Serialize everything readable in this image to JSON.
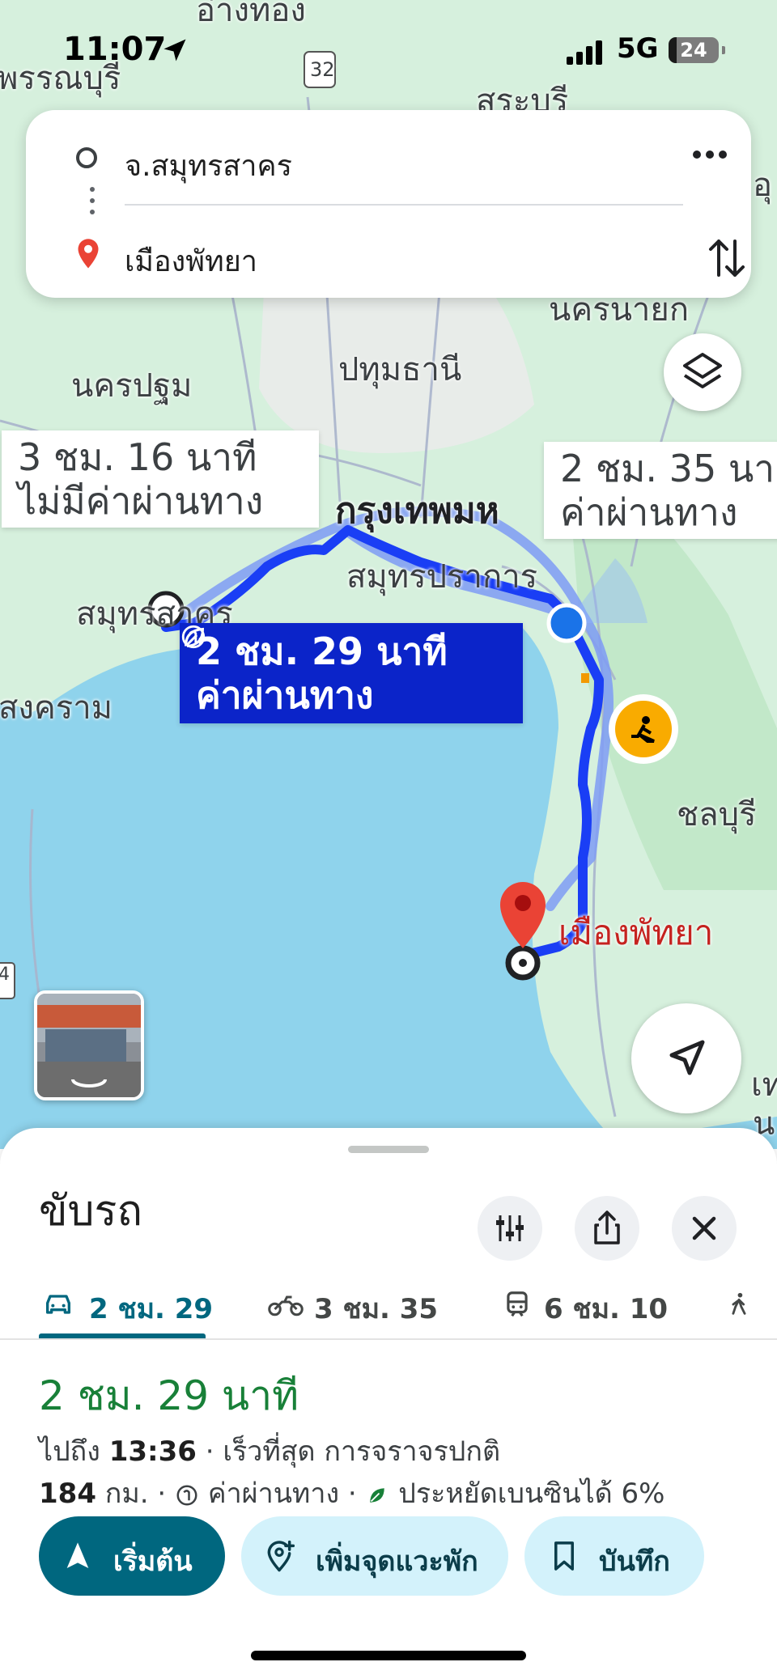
{
  "status_bar": {
    "time": "11:07",
    "network": "5G",
    "battery": "24"
  },
  "route_card": {
    "origin": "จ.สมุทรสาคร",
    "destination": "เมืองพัทยา"
  },
  "map": {
    "labels": {
      "top_cut": "อ่างทอง",
      "suphan": "พรรณบุรี",
      "saraburi": "สระบุรี",
      "nakhon_pathom": "นครปฐม",
      "pathum_thani": "ปทุมธานี",
      "bangkok": "กรุงเทพมห",
      "samut_prakan": "สมุทรปราการ",
      "samut_sakhon": "สมุทรสาคร",
      "songkhram": "สงคราม",
      "chonburi": "ชลบุรี",
      "nakhon_nayok_cut": "นครนายก",
      "pattaya": "เมืองพัทยา",
      "right_edge_1": "อุ",
      "right_edge_2": "เท",
      "right_edge_3": "น",
      "route_shield": "32",
      "left_shield": "4"
    },
    "callouts": {
      "alt1_time": "3 ชม. 16 นาที",
      "alt1_toll": "ไม่มีค่าผ่านทาง",
      "alt2_time": "2 ชม. 35 นา",
      "alt2_toll": "ค่าผ่านทาง",
      "main_time": "2 ชม. 29 นาที",
      "main_toll": "ค่าผ่านทาง"
    },
    "colors": {
      "route": "#1a3ef5",
      "route_main_label": "#0b24c9",
      "sea": "#8fd3ec",
      "land": "#cfeed8"
    }
  },
  "sheet": {
    "title": "ขับรถ",
    "tabs": [
      {
        "label": "2 ชม. 29",
        "icon": "car-icon"
      },
      {
        "label": "3 ชม. 35",
        "icon": "motorcycle-icon"
      },
      {
        "label": "6 ชม. 10",
        "icon": "train-icon"
      },
      {
        "label": "",
        "icon": "walk-icon"
      }
    ],
    "duration": "2 ชม. 29 นาที",
    "arrival_prefix": "ไปถึง",
    "arrival_time": "13:36",
    "arrival_suffix": "· เร็วที่สุด การจราจรปกติ",
    "distance": "184",
    "distance_unit": "กม. ·",
    "toll_text": "ค่าผ่านทาง ·",
    "fuel_text": "ประหยัดเบนซินได้ 6%",
    "buttons": {
      "start": "เริ่มต้น",
      "add_stop": "เพิ่มจุดแวะพัก",
      "save": "บันทึก"
    },
    "colors": {
      "accent": "#00677f",
      "green": "#188038",
      "chip": "#d3f2fb"
    }
  }
}
